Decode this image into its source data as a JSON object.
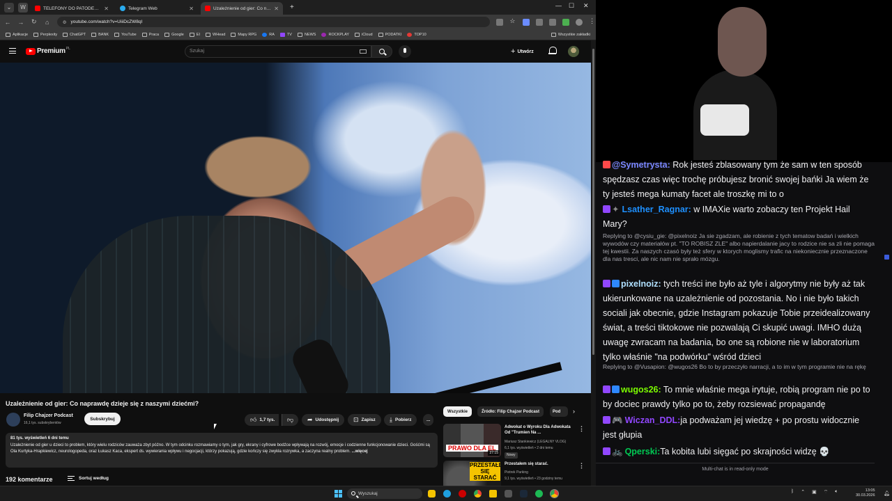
{
  "browser": {
    "tabs": [
      {
        "label": "TELEFONY DO PATODEWELOPERÓW",
        "fav": "#ff0000"
      },
      {
        "label": "Telegram Web",
        "fav": "#2aabee"
      },
      {
        "label": "Uzależnienie od gier: Co napra",
        "fav": "#ff0000"
      }
    ],
    "new_tab": "+",
    "url": "youtube.com/watch?v=UiiiDcZW8qI",
    "bookmarks": [
      "Aplikacje",
      "Perplexity",
      "ChatGPT",
      "BANK",
      "YouTube",
      "Praca",
      "Google",
      "EI",
      "WHead",
      "Mapy RPG",
      "RA",
      "TV",
      "NEWS",
      "ROCKPLAY",
      "iCloud",
      "PODATKI",
      "TOP10"
    ],
    "bookmarks_all": "Wszystkie zakładki"
  },
  "youtube": {
    "logo_text": "Premium",
    "logo_country": "PL",
    "search_placeholder": "Szukaj",
    "create_label": "Utwórz",
    "video": {
      "title": "Uzależnienie od gier: Co naprawdę dzieje się z naszymi dziećmi?",
      "channel": "Filip Chajzer Podcast",
      "subs": "16,1 tys. subskrybentów",
      "subscribe": "Subskrybuj",
      "likes": "1,7 tys.",
      "share": "Udostępnij",
      "save": "Zapisz",
      "download": "Pobierz",
      "more": "...",
      "desc_meta": "81 tys. wyświetleń  6 dni temu",
      "desc_text": "Uzależnienie od gier u dzieci to problem, który wielu rodziców zauważa zbyt późno. W tym odcinku rozmawiamy o tym, jak gry, ekrany i cyfrowe bodźce wpływają na rozwój, emocje i codzienne funkcjonowanie dzieci. Gośćmi są Ola Kurtyka-Hrapkiewicz, neurologopeda, oraz Łukasz Kaca, ekspert ds. wywierania wpływu i negocjacji, którzy pokazują, gdzie kończy się zwykła rozrywka, a zaczyna realny problem.",
      "desc_more": "...więcej",
      "comments": "192 komentarze",
      "sort": "Sortuj według"
    },
    "chips": [
      "Wszystkie",
      "Źródło: Filip Chajzer Podcast",
      "Pod"
    ],
    "recs": [
      {
        "title": "Adwokat o Wyroku Dla Adwokata Od \"Trumien Na ...",
        "channel": "Mariusz Stankiewicz (LEGALNY VLOG)",
        "meta": "6,1 tys. wyświetleń • 2 dni temu",
        "badge": "Nowy",
        "thumb_text": "PRAWO DLA EL",
        "duration": "27:15"
      },
      {
        "title": "Przestałem się starać.",
        "channel": "Piotrek Parking",
        "meta": "9,1 tys. wyświetleń • 23 godziny temu",
        "thumb_text": "PRZESTAŁEM SIĘ STARAĆ"
      }
    ]
  },
  "chat": {
    "messages": [
      {
        "user": "@Symetrysta:",
        "text": " Rok jesteś zblasowany tym że sam w ten sposób spędzasz czas więc trochę próbujesz bronić swojej bańki Ja wiem że ty jesteś mega kumaty facet ale troszkę mi to o",
        "color": "#7a87ff"
      },
      {
        "user": "Lsather_Ragnar:",
        "text": " w IMAXie warto zobaczy ten Projekt Hail Mary?",
        "color": "#1e90ff"
      },
      {
        "reply": "Replying to @cysiu_gie: @pixelnoiz Ja sie zgadzam, ale robienie z tych tematow badań i wielkich wywodów czy materiałów pt. \"TO ROBISZ ZLE\" albo napierdalanie jacy to rodzice nie sa zli nie pomaga tej kwestii. Za naszych czasó były też sfery w ktorych moglismy trafic na niekoniecznie przeznaczone dla nas tresci, ale nic nam nie sprało mózgu."
      },
      {
        "user": "pixelnoiz:",
        "text": " tych treści ine było aż tyle i algorytmy nie były aż tak ukierunkowane na uzależnienie od pozostania. No i nie było takich sociali jak obecnie, gdzie Instagram pokazuje Tobie przeidealizowany świat, a treści tiktokowe nie pozwalają Ci skupić uwagi. IMHO dużą uwagę zwracam na badania, bo one są robione nie w laboratorium tylko właśnie \"na podwórku\" wśród dzieci",
        "color": "#b0e0ff"
      },
      {
        "reply": "Replying to @Vusapion: @wugos26 Bo to by przeczyło narracji, a to im w tym programie nie na rękę"
      },
      {
        "user": "wugos26:",
        "text": " To mnie właśnie mega irytuje, robią program nie po to by dociec prawdy tylko po to, żeby rozsiewać propagandę",
        "color": "#7cfc00"
      },
      {
        "user": "Wiczan_DDL:",
        "text": "ja podważam jej wiedzę + po prostu widocznie jest głupia",
        "color": "#9147ff"
      },
      {
        "user": "Qperski:",
        "text": "Ta kobita lubi sięgać po skrajności widzę 💀",
        "color": "#00c853"
      }
    ],
    "readonly": "Multi-chat is in read-only mode"
  },
  "taskbar": {
    "search": "Wyszukaj",
    "time": "13:05",
    "date": "30.03.2026"
  }
}
